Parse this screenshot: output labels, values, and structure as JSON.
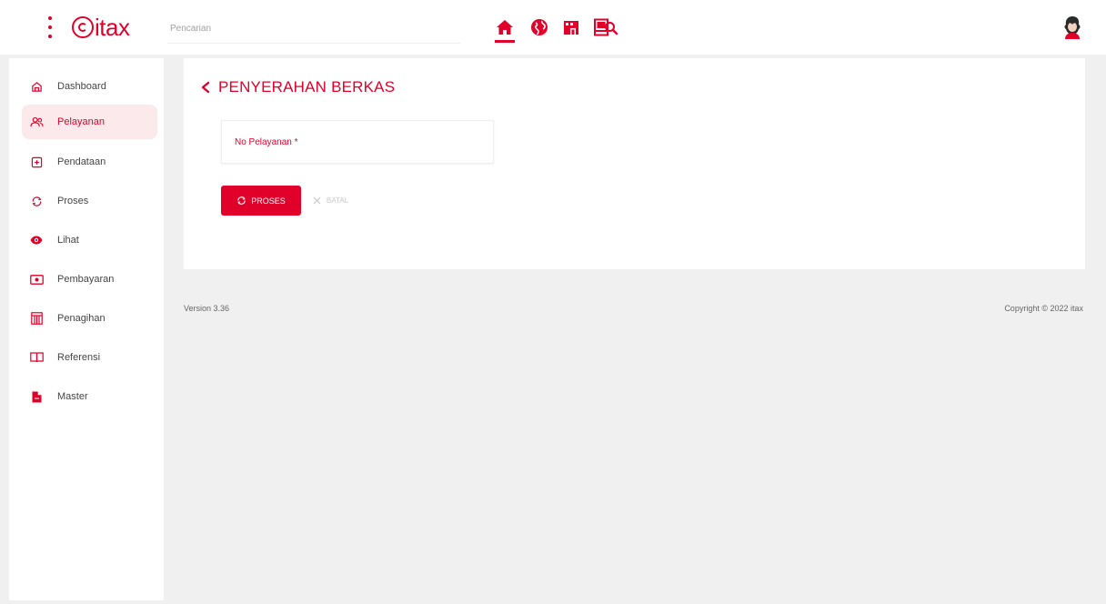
{
  "app": {
    "logo_text": "itax",
    "brand_color": "#e0002a"
  },
  "search": {
    "placeholder": "Pencarian"
  },
  "top_nav": {
    "icons": [
      "home-icon",
      "globe-icon",
      "building-icon",
      "book-icon"
    ],
    "active": "home-icon"
  },
  "sidebar": {
    "items": [
      {
        "label": "Dashboard",
        "icon": "home-outline-icon"
      },
      {
        "label": "Pelayanan",
        "icon": "users-icon",
        "active": true
      },
      {
        "label": "Pendataan",
        "icon": "add-box-icon"
      },
      {
        "label": "Proses",
        "icon": "refresh-icon"
      },
      {
        "label": "Lihat",
        "icon": "eye-icon"
      },
      {
        "label": "Pembayaran",
        "icon": "cash-icon"
      },
      {
        "label": "Penagihan",
        "icon": "building-columns-icon"
      },
      {
        "label": "Referensi",
        "icon": "open-book-icon"
      },
      {
        "label": "Master",
        "icon": "file-icon"
      }
    ]
  },
  "main": {
    "title": "PENYERAHAN BERKAS",
    "field_placeholder": "No Pelayanan *",
    "field_value": "",
    "proses_label": "PROSES",
    "batal_label": "BATAL"
  },
  "footer": {
    "version": "Version 3.36",
    "copyright": "Copyright © 2022 itax"
  }
}
